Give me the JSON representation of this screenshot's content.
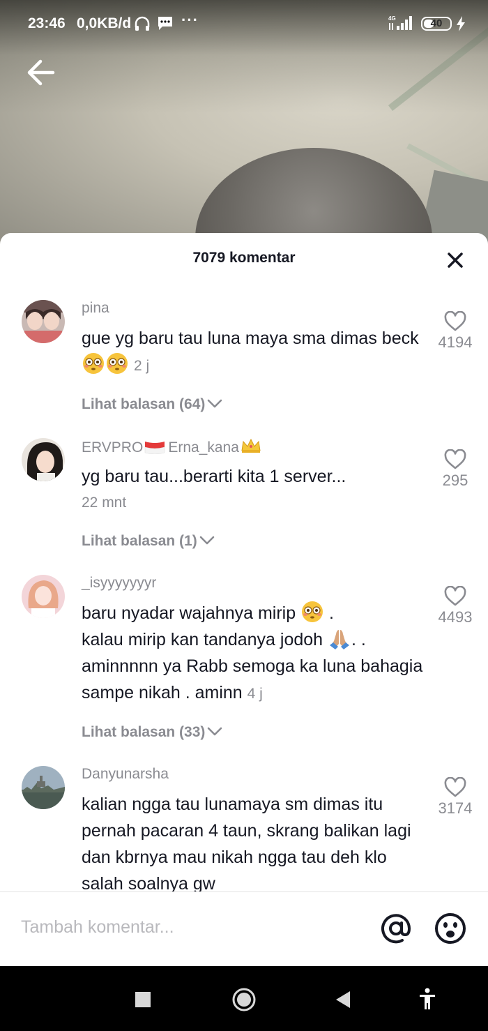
{
  "status_bar": {
    "time": "23:46",
    "network_speed": "0,0KB/d",
    "more_dots": "···",
    "signal_label": "4G",
    "battery": "40",
    "battery_level": 0.4
  },
  "comments_panel": {
    "title": "7079 komentar",
    "comments": [
      {
        "username": "pina",
        "text": "gue yg baru tau luna maya sma dimas beck",
        "time": "2 j",
        "likes": "4194",
        "replies": "Lihat balasan (64)"
      },
      {
        "username": "ERVPRO",
        "username_suffix": "Erna_kana",
        "text": "yg baru tau...berarti kita 1 server...",
        "time": "22 mnt",
        "likes": "295",
        "replies": "Lihat balasan (1)"
      },
      {
        "username": "_isyyyyyyyr",
        "text_1": "baru nyadar wajahnya mirip",
        "text_2": ".",
        "text_3": "kalau mirip kan tandanya jodoh",
        "text_4": ". .",
        "text_5": "aminnnnn ya Rabb semoga ka luna bahagia sampe nikah . aminn",
        "time": "4 j",
        "likes": "4493",
        "replies": "Lihat balasan (33)"
      },
      {
        "username": "Danyunarsha",
        "text": "kalian ngga tau lunamaya sm dimas itu pernah pacaran 4 taun, skrang balikan lagi dan kbrnya mau nikah ngga tau deh klo salah soalnya gw",
        "likes": "3174"
      }
    ]
  },
  "input_bar": {
    "placeholder": "Tambah komentar..."
  },
  "colors": {
    "text_primary": "#161823",
    "text_secondary": "#8a8b91",
    "divider": "#e3e3e4"
  },
  "icons": [
    "back-arrow-icon",
    "close-icon",
    "heart-icon",
    "chevron-down-icon",
    "at-icon",
    "emoji-icon",
    "flushed-face-emoji",
    "praying-hands-emoji",
    "indonesia-flag-emoji",
    "crown-emoji",
    "square-nav-icon",
    "circle-nav-icon",
    "triangle-nav-icon",
    "accessibility-icon"
  ]
}
